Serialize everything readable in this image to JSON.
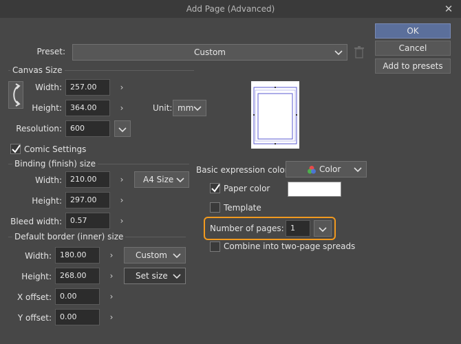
{
  "window": {
    "title": "Add Page (Advanced)"
  },
  "buttons": {
    "ok": "OK",
    "cancel": "Cancel",
    "add_to_presets": "Add to presets"
  },
  "preset": {
    "label": "Preset:",
    "value": "Custom"
  },
  "canvas_size": {
    "title": "Canvas Size",
    "width_label": "Width:",
    "width": "257.00",
    "height_label": "Height:",
    "height": "364.00",
    "unit_label": "Unit:",
    "unit": "mm",
    "resolution_label": "Resolution:",
    "resolution": "600"
  },
  "comic_settings": {
    "label": "Comic Settings",
    "checked": true
  },
  "binding": {
    "title": "Binding (finish) size",
    "width_label": "Width:",
    "width": "210.00",
    "size_preset": "A4 Size",
    "height_label": "Height:",
    "height": "297.00",
    "bleed_label": "Bleed width:",
    "bleed": "0.57"
  },
  "border": {
    "title": "Default border (inner) size",
    "width_label": "Width:",
    "width": "180.00",
    "preset": "Custom",
    "height_label": "Height:",
    "height": "268.00",
    "set_size": "Set size",
    "xoffset_label": "X offset:",
    "xoffset": "0.00",
    "yoffset_label": "Y offset:",
    "yoffset": "0.00"
  },
  "expression": {
    "label": "Basic expression color:",
    "value": "Color"
  },
  "paper_color": {
    "label": "Paper color",
    "checked": true,
    "color": "#ffffff"
  },
  "template": {
    "label": "Template",
    "checked": false
  },
  "pages": {
    "label": "Number of pages:",
    "value": "1"
  },
  "spreads": {
    "label": "Combine into two-page spreads",
    "checked": false
  },
  "colors": {
    "accent_highlight": "#f29a1f",
    "ok_button": "#5b6f9b",
    "background": "#474747"
  }
}
